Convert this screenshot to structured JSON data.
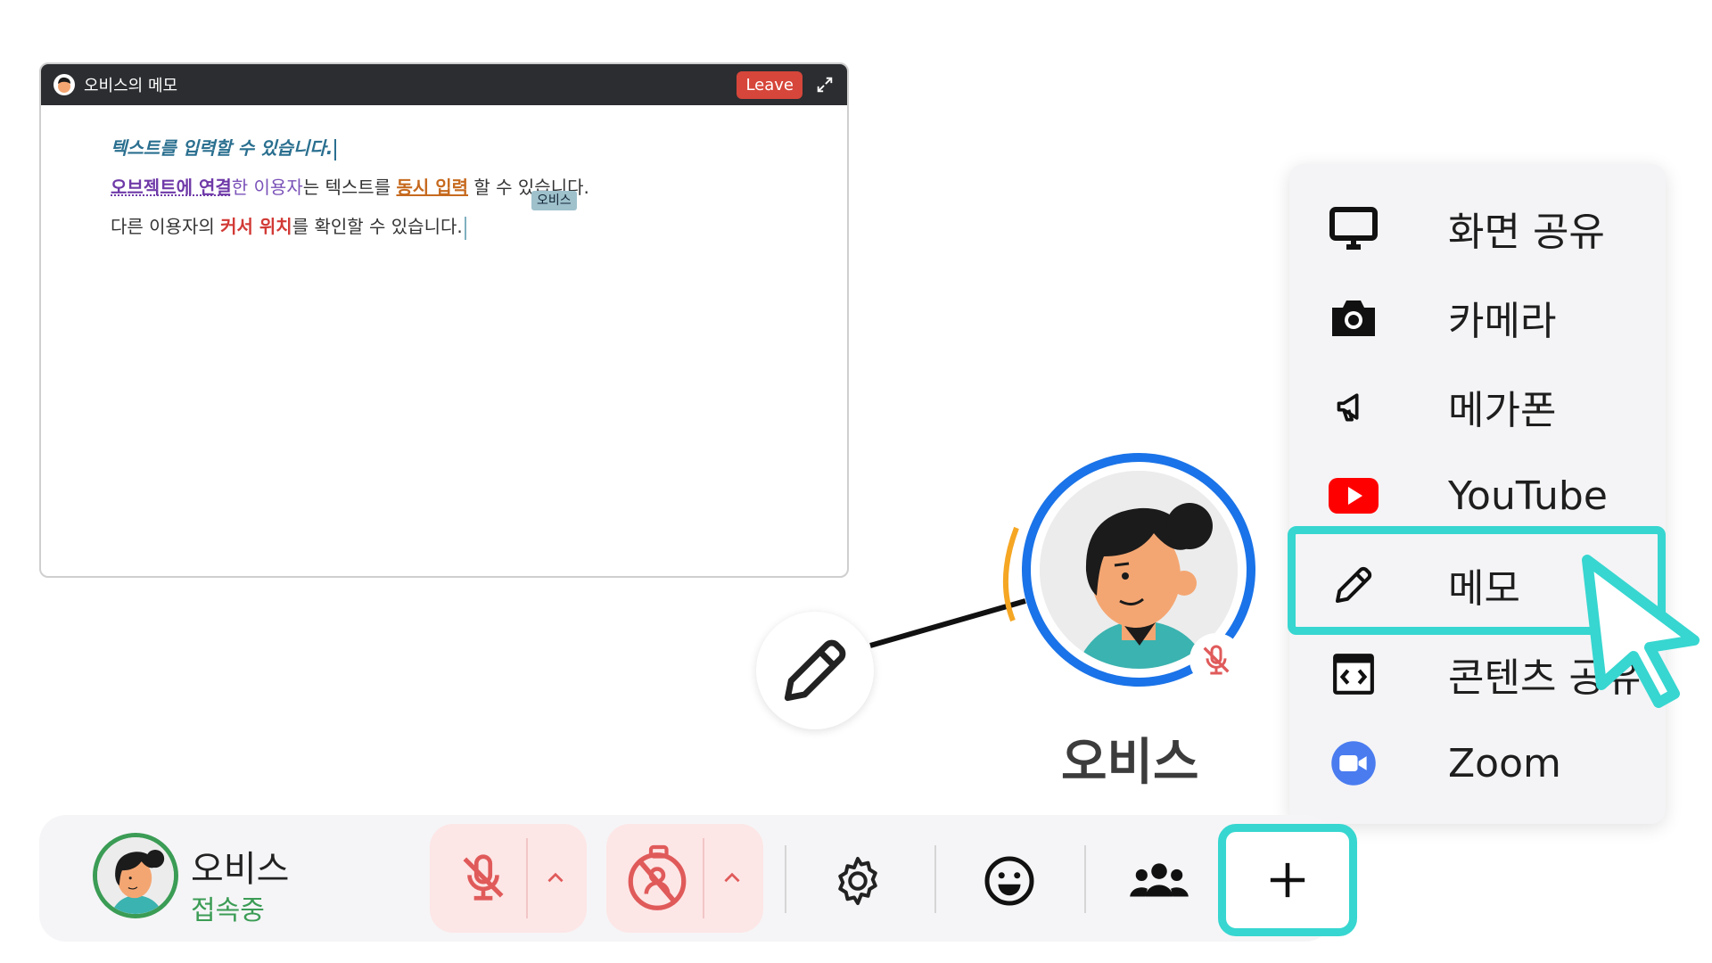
{
  "memo": {
    "title": "오비스의 메모",
    "leave_label": "Leave",
    "line1": "텍스트를 입력할 수 있습니다.",
    "line2": {
      "seg1": "오브젝트에 연결",
      "seg2": "한 이용자",
      "seg3": "는 텍스트를 ",
      "seg4": "동시 입력",
      "seg5": " 할 수 있습니다."
    },
    "line3": {
      "seg1": "다른 이용자의 ",
      "seg2": "커서 위치",
      "seg3": "를 확인할 수 있습니다."
    },
    "cursor_tag": "오비스"
  },
  "menu": {
    "items": [
      {
        "label": "화면 공유",
        "icon": "monitor-icon"
      },
      {
        "label": "카메라",
        "icon": "camera-icon"
      },
      {
        "label": "메가폰",
        "icon": "megaphone-icon"
      },
      {
        "label": "YouTube",
        "icon": "youtube-icon"
      },
      {
        "label": "메모",
        "icon": "pencil-icon"
      },
      {
        "label": "콘텐츠 공유",
        "icon": "embed-icon"
      },
      {
        "label": "Zoom",
        "icon": "zoom-icon"
      }
    ],
    "selected": "메모"
  },
  "map_avatar": {
    "name": "오비스"
  },
  "toolbar": {
    "user_name": "오비스",
    "user_status": "접속중",
    "colors": {
      "status": "#3b9c55",
      "accent": "#37d6d0",
      "mic_bg": "#fde6e6"
    }
  }
}
